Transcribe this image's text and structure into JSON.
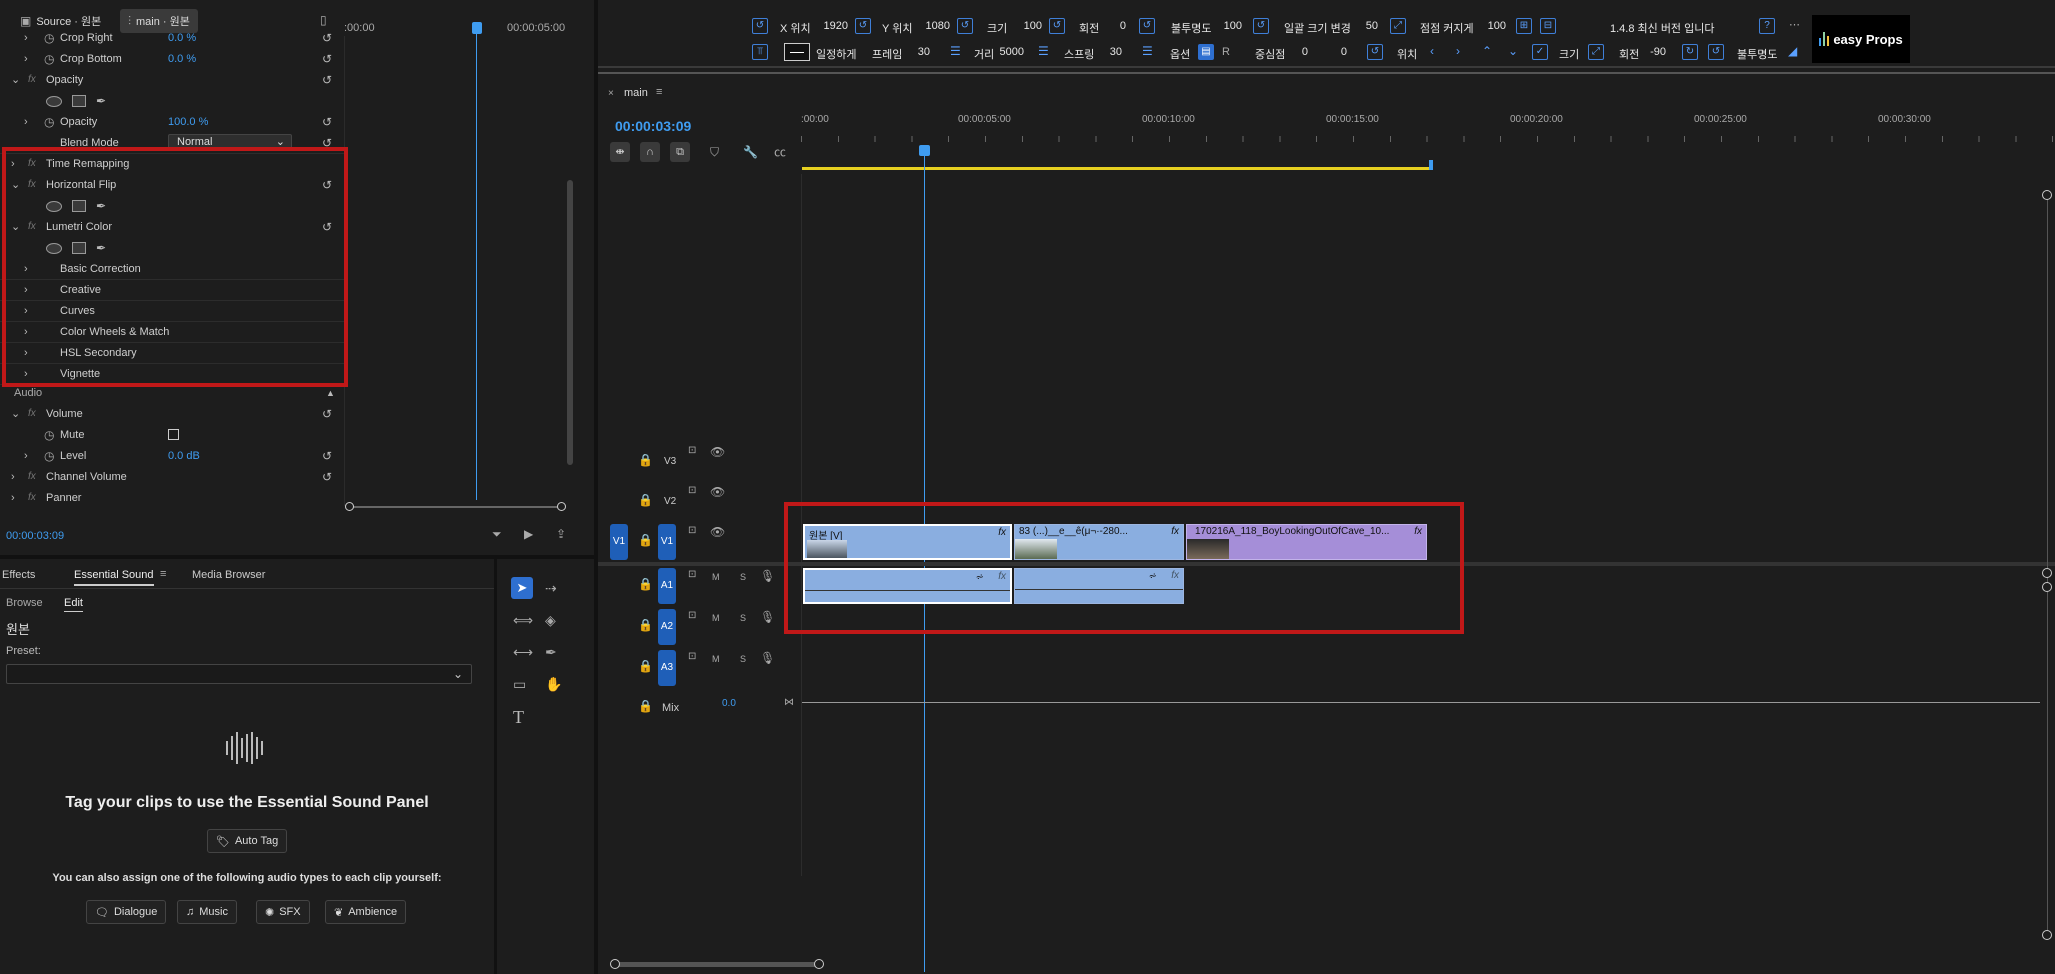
{
  "top_tabs": {
    "source_label": "Source · 원본",
    "sequence_label": "main · 원본"
  },
  "source_ruler": {
    "t0": ":00:00",
    "t1": "00:00:05:00"
  },
  "effect_controls": {
    "crop_right": {
      "label": "Crop Right",
      "value": "0.0 %"
    },
    "crop_bottom": {
      "label": "Crop Bottom",
      "value": "0.0 %"
    },
    "opacity_section": "Opacity",
    "opacity": {
      "label": "Opacity",
      "value": "100.0 %"
    },
    "blend_mode": {
      "label": "Blend Mode",
      "value": "Normal"
    },
    "time_remapping": "Time Remapping",
    "horizontal_flip": "Horizontal Flip",
    "lumetri_color": "Lumetri Color",
    "lumetri_items": [
      "Basic Correction",
      "Creative",
      "Curves",
      "Color Wheels & Match",
      "HSL Secondary",
      "Vignette"
    ],
    "audio_header": "Audio",
    "volume": "Volume",
    "mute": "Mute",
    "level": {
      "label": "Level",
      "value": "0.0 dB"
    },
    "channel_volume": "Channel Volume",
    "panner": "Panner",
    "timecode": "00:00:03:09"
  },
  "lower_panel": {
    "tabs": [
      "Effects",
      "Essential Sound",
      "Media Browser"
    ],
    "subtabs": [
      "Browse",
      "Edit"
    ],
    "clip_name": "원본",
    "preset_label": "Preset:",
    "tag_title": "Tag your clips to use the Essential Sound Panel",
    "auto_tag": "Auto Tag",
    "assign_text": "You can also assign one of the following audio types to each clip yourself:",
    "types": [
      "Dialogue",
      "Music",
      "SFX",
      "Ambience"
    ]
  },
  "toolbar": {
    "x_label": "X 위치",
    "x_value": "1920",
    "y_label": "Y 위치",
    "y_value": "1080",
    "size_label": "크기",
    "size_value": "100",
    "rotate_label": "회전",
    "rotate_value": "0",
    "opacity_label": "불투명도",
    "opacity_value": "100",
    "bulk_label": "일괄 크기 변경",
    "bulk_value": "50",
    "grow_label": "점점 커지게",
    "grow_value": "100",
    "version": "1.4.8 최신 버전 입니다",
    "uniform_label": "일정하게",
    "frame_label": "프레임",
    "frame_value": "30",
    "dist_label": "거리",
    "dist_value": "5000",
    "spring_label": "스프링",
    "spring_value": "30",
    "option_label": "옵션",
    "center_label": "중심점",
    "center_x": "0",
    "center_y": "0",
    "pos_label": "위치",
    "size2_label": "크기",
    "rotate2_label": "회전",
    "rotate2_value": "-90",
    "opacity2_label": "불투명도",
    "brand": "easy Props",
    "r_label": "R"
  },
  "timeline": {
    "seq_name": "main",
    "timecode": "00:00:03:09",
    "ruler": [
      ":00:00",
      "00:00:05:00",
      "00:00:10:00",
      "00:00:15:00",
      "00:00:20:00",
      "00:00:25:00",
      "00:00:30:00"
    ],
    "tracks": {
      "v3": "V3",
      "v2": "V2",
      "v1": "V1",
      "a1": "A1",
      "a2": "A2",
      "a3": "A3",
      "mix": "Mix",
      "mix_value": "0.0",
      "m": "M",
      "s": "S"
    },
    "clips": {
      "clip1": "원본 [V]",
      "clip2": "83 (...)__e__ê(μ¬·-280...",
      "clip3": "170216A_118_BoyLookingOutOfCave_10...",
      "fx": "fx"
    }
  }
}
